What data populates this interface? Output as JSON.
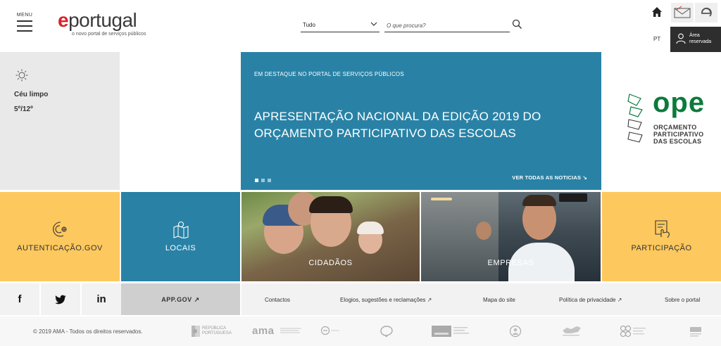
{
  "header": {
    "menu_label": "MENU",
    "logo_text": "portugal",
    "logo_e": "e",
    "tagline": "o novo portal de serviços públicos",
    "search": {
      "scope": "Tudo",
      "placeholder": "O que procura?"
    },
    "lang": "PT",
    "area_label": "Área reservada"
  },
  "weather": {
    "condition": "Céu limpo",
    "temperature": "5º/12º"
  },
  "featured": {
    "kicker": "EM DESTAQUE NO PORTAL DE SERVIÇOS PÚBLICOS",
    "headline": "APRESENTAÇÃO NACIONAL DA EDIÇÃO 2019 DO ORÇAMENTO PARTICIPATIVO DAS ESCOLAS",
    "all_news": "VER TODAS AS NOTICIAS ↘",
    "slides": 3,
    "active_slide": 1
  },
  "ope": {
    "name": "ope",
    "line1": "ORÇAMENTO",
    "line2": "PARTICIPATIVO",
    "line3": "DAS ESCOLAS"
  },
  "tiles": {
    "auth": "AUTENTICAÇÃO.GOV",
    "locais": "LOCAIS",
    "cidadaos": "CIDADÃOS",
    "empresas": "EMPRESAS",
    "participacao": "PARTICIPAÇÃO"
  },
  "social": {
    "facebook": "f",
    "twitter": "twitter-icon",
    "linkedin": "in"
  },
  "appgov": "APP.GOV ↗",
  "links": {
    "contactos": "Contactos",
    "elogios": "Elogios, sugestões e reclamações ↗",
    "mapa": "Mapa do site",
    "privacidade": "Política de privacidade ↗",
    "sobre": "Sobre o portal"
  },
  "footer": {
    "copyright": "© 2019 AMA - Todos os direitos reservados.",
    "republica": "REPÚBLICA PORTUGUESA",
    "ama": "ama"
  },
  "colors": {
    "blue": "#2982a6",
    "yellow": "#fdc85e",
    "green": "#0c7a3c",
    "red": "#d8232a"
  }
}
